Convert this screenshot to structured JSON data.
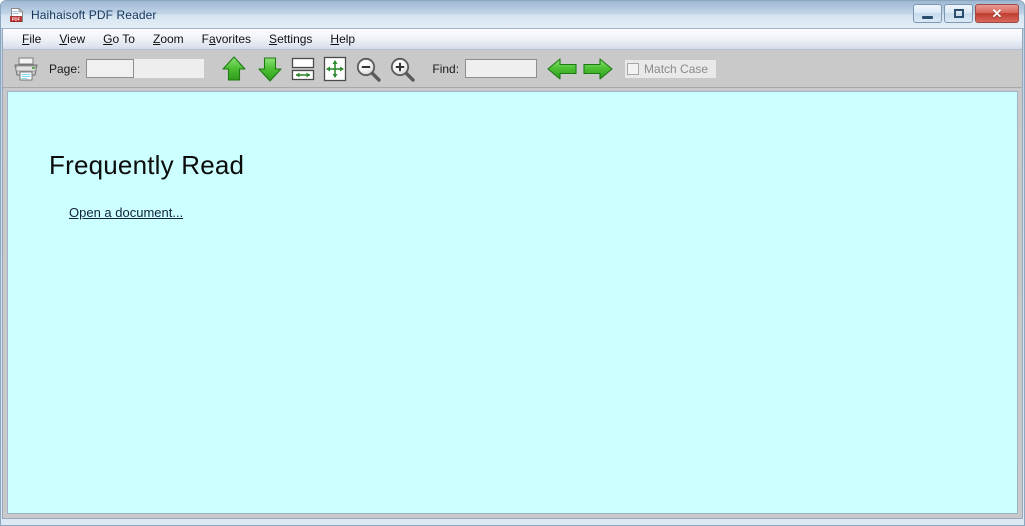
{
  "window": {
    "title": "Haihaisoft PDF Reader",
    "icon": "pdf-document-icon",
    "controls": {
      "minimize": "Minimize",
      "maximize": "Maximize",
      "close": "Close",
      "close_glyph": "✕"
    },
    "frame_color": "#cfe0ef",
    "titlebar_text_color": "#14365c"
  },
  "menubar": {
    "items": [
      {
        "label": "File",
        "pre": "",
        "accel": "F",
        "post": "ile"
      },
      {
        "label": "View",
        "pre": "",
        "accel": "V",
        "post": "iew"
      },
      {
        "label": "Go To",
        "pre": "",
        "accel": "G",
        "post": "o To"
      },
      {
        "label": "Zoom",
        "pre": "",
        "accel": "Z",
        "post": "oom"
      },
      {
        "label": "Favorites",
        "pre": "F",
        "accel": "a",
        "post": "vorites"
      },
      {
        "label": "Settings",
        "pre": "",
        "accel": "S",
        "post": "ettings"
      },
      {
        "label": "Help",
        "pre": "",
        "accel": "H",
        "post": "elp"
      }
    ]
  },
  "toolbar": {
    "print_icon": "printer-icon",
    "page_label": "Page:",
    "page_value": "",
    "page_placeholder": "",
    "page_total": "",
    "prev_page_icon": "green-up-arrow-icon",
    "next_page_icon": "green-down-arrow-icon",
    "fit_width_icon": "fit-width-icon",
    "fit_page_icon": "fit-page-icon",
    "zoom_out_icon": "zoom-out-magnifier-icon",
    "zoom_in_icon": "zoom-in-magnifier-icon",
    "find_label": "Find:",
    "find_value": "",
    "find_placeholder": "",
    "find_prev_icon": "green-left-arrow-icon",
    "find_next_icon": "green-right-arrow-icon",
    "match_case_label": "Match Case",
    "match_case_checked": false,
    "match_case_disabled": true,
    "background_color": "#c9c9c9"
  },
  "document_pane": {
    "background_color": "#ccffff",
    "heading": "Frequently Read",
    "open_link": "Open a document..."
  }
}
